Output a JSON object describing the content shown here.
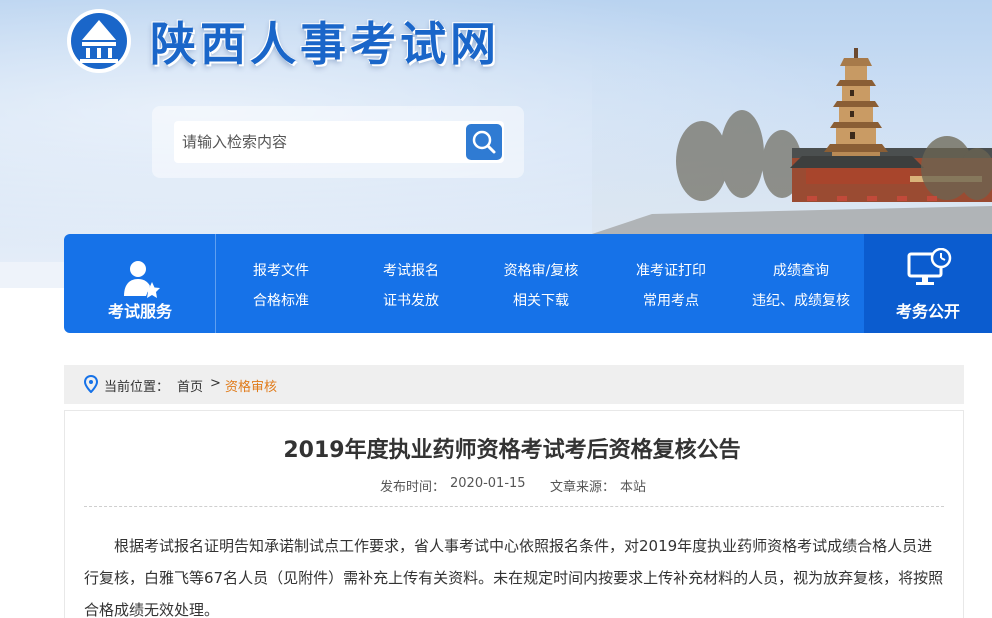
{
  "header": {
    "site_title": "陕西人事考试网",
    "search_placeholder": "请输入检索内容"
  },
  "nav": {
    "left_label": "考试服务",
    "right_label": "考务公开",
    "links_row1": [
      "报考文件",
      "考试报名",
      "资格审/复核",
      "准考证打印",
      "成绩查询"
    ],
    "links_row2": [
      "合格标准",
      "证书发放",
      "相关下载",
      "常用考点",
      "违纪、成绩复核"
    ]
  },
  "breadcrumb": {
    "prefix": "当前位置：",
    "home": "首页",
    "separator": ">",
    "current": "资格审核"
  },
  "article": {
    "title": "2019年度执业药师资格考试考后资格复核公告",
    "publish_label": "发布时间：",
    "publish_date": "2020-01-15",
    "source_label": "文章来源：",
    "source": "本站",
    "body": "根据考试报名证明告知承诺制试点工作要求，省人事考试中心依照报名条件，对2019年度执业药师资格考试成绩合格人员进行复核，白雅飞等67名人员（见附件）需补充上传有关资料。未在规定时间内按要求上传补充材料的人员，视为放弃复核，将按照合格成绩无效处理。"
  },
  "colors": {
    "brand_blue": "#1672e8",
    "title_blue": "#1a66c9",
    "breadcrumb_current": "#e07b1a"
  }
}
